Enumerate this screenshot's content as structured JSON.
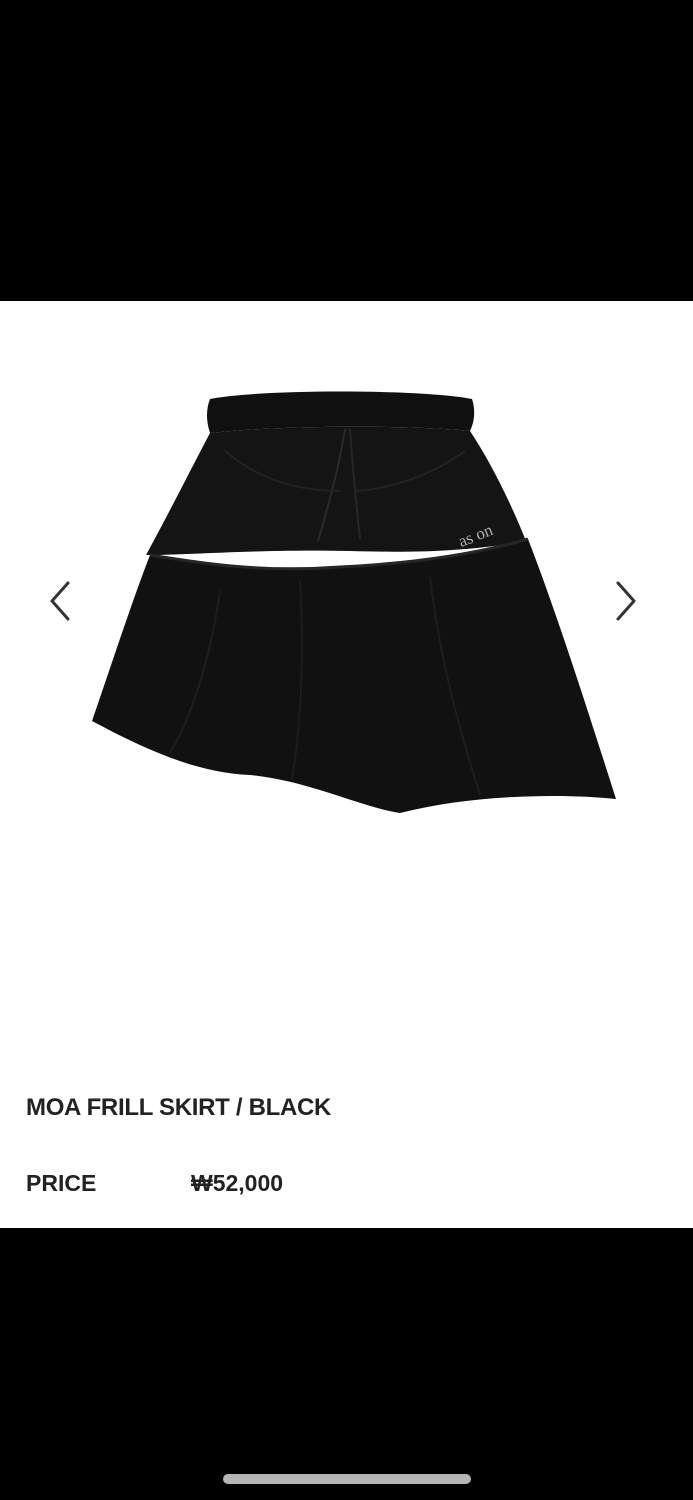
{
  "product": {
    "title": "MOA FRILL SKIRT / BLACK",
    "image_alt": "black asymmetric frill skirt",
    "image_logo_text": "as on",
    "price_label": "PRICE",
    "price_value": "₩52,000"
  },
  "carousel": {
    "prev_icon": "chevron-left-icon",
    "next_icon": "chevron-right-icon"
  },
  "colors": {
    "background_dark": "#000000",
    "card": "#ffffff",
    "text": "#222222",
    "skirt": "#111111",
    "home_indicator": "#b5b5b5"
  }
}
